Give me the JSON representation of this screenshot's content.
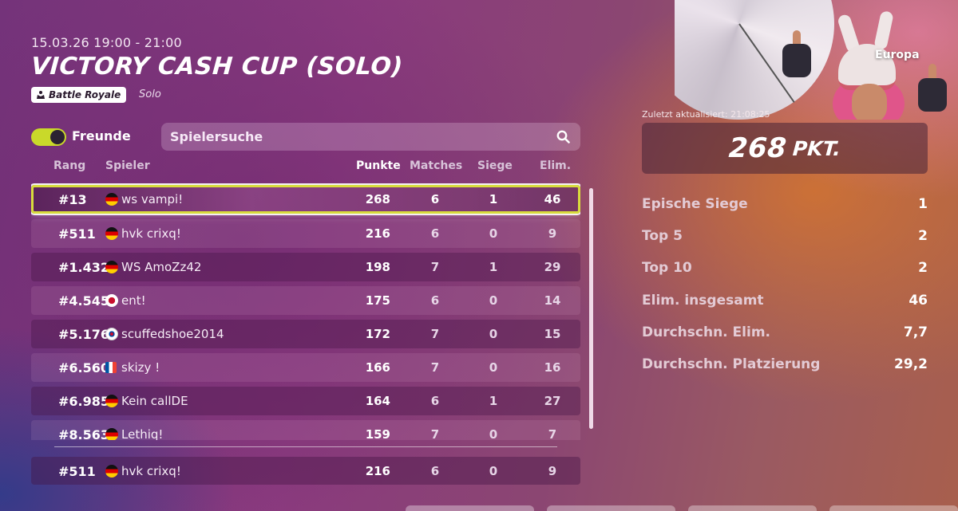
{
  "header": {
    "date": "15.03.26 19:00 - 21:00",
    "title": "VICTORY CASH CUP (SOLO)",
    "mode_badge": "Battle Royale",
    "mode_sub": "Solo"
  },
  "controls": {
    "friends_toggle_label": "Freunde",
    "friends_toggle_on": true,
    "search_placeholder": "Spielersuche"
  },
  "table": {
    "columns": {
      "rank": "Rang",
      "player": "Spieler",
      "points": "Punkte",
      "matches": "Matches",
      "wins": "Siege",
      "elims": "Elim."
    },
    "rows": [
      {
        "rank": "#13",
        "flag": "de",
        "name": "ws vampi!",
        "points": "268",
        "matches": "6",
        "wins": "1",
        "elims": "46"
      },
      {
        "rank": "#511",
        "flag": "de",
        "name": "hvk crixq!",
        "points": "216",
        "matches": "6",
        "wins": "0",
        "elims": "9"
      },
      {
        "rank": "#1.432",
        "flag": "de",
        "name": "WS AmoZz42",
        "points": "198",
        "matches": "7",
        "wins": "1",
        "elims": "29"
      },
      {
        "rank": "#4.545",
        "flag": "jp",
        "name": "ent!",
        "points": "175",
        "matches": "6",
        "wins": "0",
        "elims": "14"
      },
      {
        "rank": "#5.176",
        "flag": "kr",
        "name": "scuffedshoe2014",
        "points": "172",
        "matches": "7",
        "wins": "0",
        "elims": "15"
      },
      {
        "rank": "#6.560",
        "flag": "fr",
        "name": "skizy !",
        "points": "166",
        "matches": "7",
        "wins": "0",
        "elims": "16"
      },
      {
        "rank": "#6.985",
        "flag": "de",
        "name": "Kein callDE",
        "points": "164",
        "matches": "6",
        "wins": "1",
        "elims": "27"
      },
      {
        "rank": "#8.563",
        "flag": "de",
        "name": "Lethiq!",
        "points": "159",
        "matches": "7",
        "wins": "0",
        "elims": "7"
      }
    ],
    "my_row": {
      "rank": "#511",
      "flag": "de",
      "name": "hvk crixq!",
      "points": "216",
      "matches": "6",
      "wins": "0",
      "elims": "9"
    }
  },
  "panel": {
    "region": "Europa",
    "updated": "Zuletzt aktualisiert: 21:08:25",
    "score_value": "268",
    "score_unit": "PKT.",
    "stats": [
      {
        "label": "Epische Siege",
        "value": "1"
      },
      {
        "label": "Top 5",
        "value": "2"
      },
      {
        "label": "Top 10",
        "value": "2"
      },
      {
        "label": "Elim. insgesamt",
        "value": "46"
      },
      {
        "label": "Durchschn. Elim.",
        "value": "7,7"
      },
      {
        "label": "Durchschn. Platzierung",
        "value": "29,2"
      }
    ]
  },
  "colors": {
    "highlight_border": "#d8dc3c",
    "toggle_on": "#c9d92a"
  }
}
